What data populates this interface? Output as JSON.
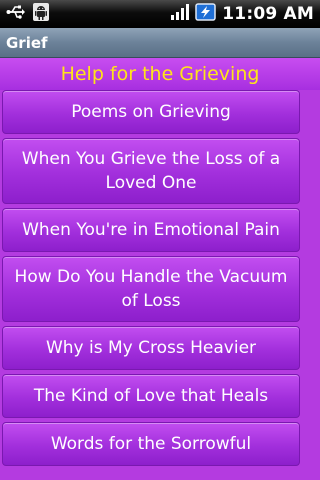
{
  "status_bar": {
    "time": "11:09 AM",
    "icons": [
      "usb-icon",
      "android-debug-icon",
      "signal-icon",
      "battery-charging-icon"
    ]
  },
  "app": {
    "title": "Grief"
  },
  "list": {
    "header": "Help for the Grieving",
    "items": [
      {
        "label": "Poems on Grieving"
      },
      {
        "label": "When You Grieve the Loss of a Loved One"
      },
      {
        "label": "When You're in Emotional Pain"
      },
      {
        "label": "How Do You Handle the Vacuum of Loss"
      },
      {
        "label": "Why is My Cross Heavier"
      },
      {
        "label": "The Kind of Love that Heals"
      },
      {
        "label": "Words for the Sorrowful"
      }
    ]
  },
  "colors": {
    "background": "#b43be0",
    "header_text": "#ffe419",
    "item_text": "#ffffff",
    "title_bar": "#6c8299"
  }
}
